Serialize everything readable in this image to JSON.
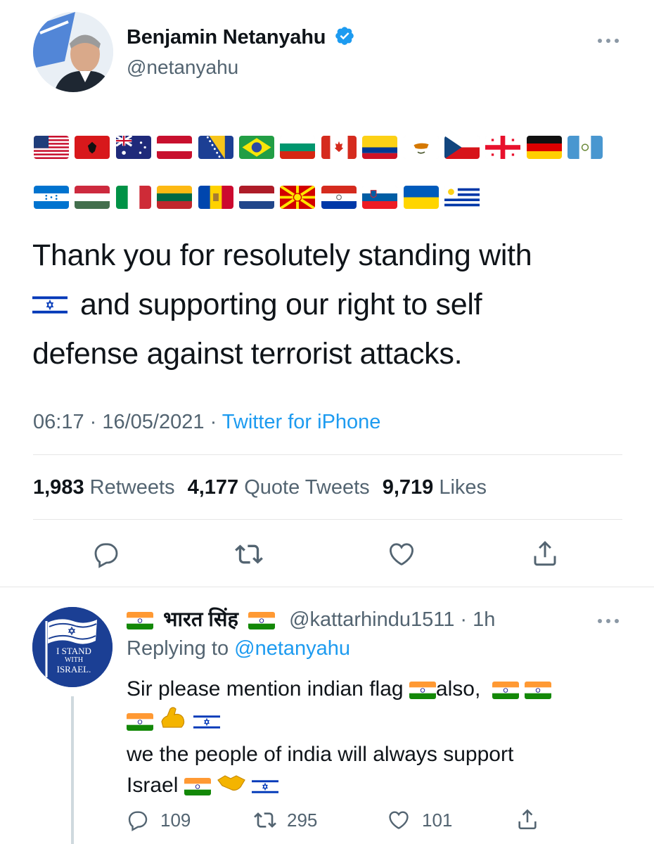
{
  "tweet": {
    "author_name": "Benjamin Netanyahu",
    "author_handle": "@netanyahu",
    "flags_row1": [
      "us",
      "al",
      "au",
      "at",
      "ba",
      "br",
      "bg",
      "ca",
      "co",
      "cy",
      "cz",
      "ge",
      "de",
      "gt"
    ],
    "flags_row2": [
      "hn",
      "hu",
      "it",
      "lt",
      "md",
      "nl",
      "mk",
      "py",
      "si",
      "ua",
      "uy"
    ],
    "text_line1": "Thank you for resolutely standing with",
    "text_line2": "and supporting our right to self",
    "text_line3": "defense against terrorist attacks.",
    "time": "06:17",
    "date": "16/05/2021",
    "source": "Twitter for iPhone",
    "retweets_count": "1,983",
    "retweets_label": "Retweets",
    "quotes_count": "4,177",
    "quotes_label": "Quote Tweets",
    "likes_count": "9,719",
    "likes_label": "Likes"
  },
  "reply": {
    "name": "भारत सिंह",
    "handle": "@kattarhindu1511",
    "time": "1h",
    "replying_label": "Replying to",
    "replying_handle": "@netanyahu",
    "avatar_text_1": "I STAND",
    "avatar_text_2": "WITH",
    "avatar_text_3": "ISRAEL.",
    "line1_a": "Sir please mention indian flag",
    "line1_b": "also,",
    "line3": "we the people of india will always support",
    "line4": "Israel",
    "reply_count": "109",
    "retweet_count": "295",
    "like_count": "101"
  },
  "colors": {
    "accent": "#1d9bf0",
    "secondary_text": "#536471",
    "divider": "#e6e6e6"
  }
}
